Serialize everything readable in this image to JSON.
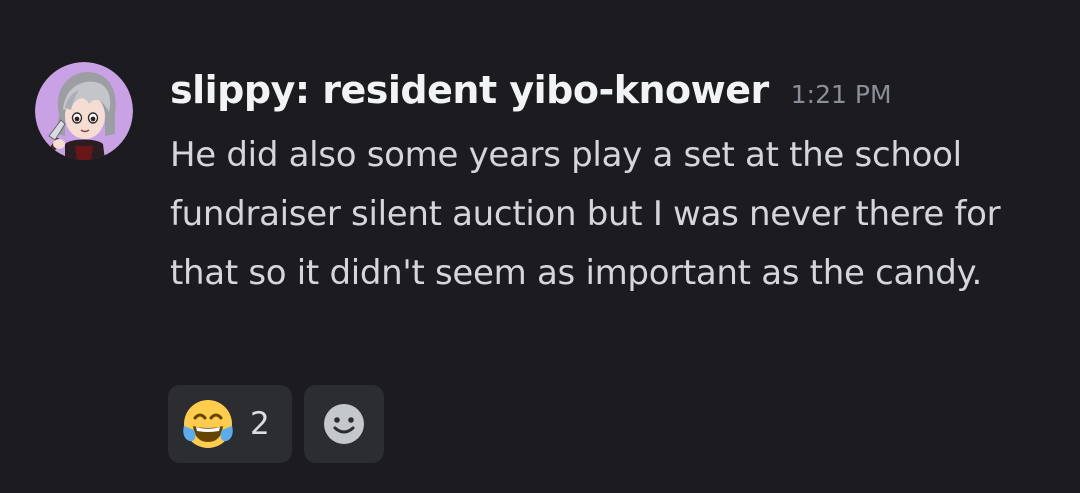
{
  "message": {
    "author": "slippy: resident yibo-knower",
    "timestamp": "1:21 PM",
    "content": "He did also some years play a set at the school fundraiser silent auction but I was never there for that so it didn't seem as important as the candy.",
    "avatar_icon": "gray-haired-character-holding-knife-avatar"
  },
  "reactions": [
    {
      "emoji": "face-with-tears-of-joy-icon",
      "count": "2"
    }
  ],
  "add_reaction": {
    "icon": "smiley-face-icon"
  },
  "colors": {
    "background": "#1c1c20",
    "reaction_background": "#2b2d31",
    "username": "#f2f3f5",
    "timestamp": "#8a8e96",
    "text": "#d4d6da"
  }
}
